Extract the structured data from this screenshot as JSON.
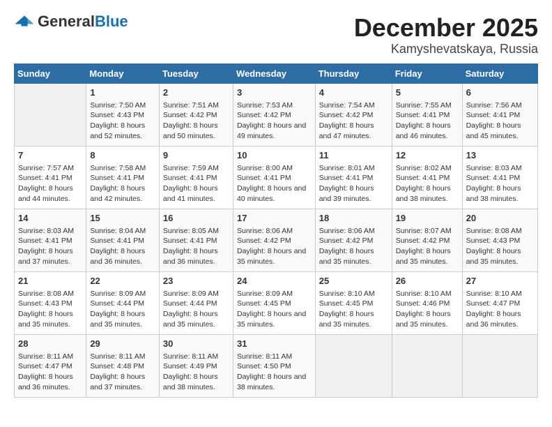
{
  "logo": {
    "line1": "General",
    "line2": "Blue"
  },
  "title": "December 2025",
  "subtitle": "Kamyshevatskaya, Russia",
  "days_header": [
    "Sunday",
    "Monday",
    "Tuesday",
    "Wednesday",
    "Thursday",
    "Friday",
    "Saturday"
  ],
  "weeks": [
    [
      {
        "day": "",
        "sunrise": "",
        "sunset": "",
        "daylight": ""
      },
      {
        "day": "1",
        "sunrise": "Sunrise: 7:50 AM",
        "sunset": "Sunset: 4:43 PM",
        "daylight": "Daylight: 8 hours and 52 minutes."
      },
      {
        "day": "2",
        "sunrise": "Sunrise: 7:51 AM",
        "sunset": "Sunset: 4:42 PM",
        "daylight": "Daylight: 8 hours and 50 minutes."
      },
      {
        "day": "3",
        "sunrise": "Sunrise: 7:53 AM",
        "sunset": "Sunset: 4:42 PM",
        "daylight": "Daylight: 8 hours and 49 minutes."
      },
      {
        "day": "4",
        "sunrise": "Sunrise: 7:54 AM",
        "sunset": "Sunset: 4:42 PM",
        "daylight": "Daylight: 8 hours and 47 minutes."
      },
      {
        "day": "5",
        "sunrise": "Sunrise: 7:55 AM",
        "sunset": "Sunset: 4:41 PM",
        "daylight": "Daylight: 8 hours and 46 minutes."
      },
      {
        "day": "6",
        "sunrise": "Sunrise: 7:56 AM",
        "sunset": "Sunset: 4:41 PM",
        "daylight": "Daylight: 8 hours and 45 minutes."
      }
    ],
    [
      {
        "day": "7",
        "sunrise": "Sunrise: 7:57 AM",
        "sunset": "Sunset: 4:41 PM",
        "daylight": "Daylight: 8 hours and 44 minutes."
      },
      {
        "day": "8",
        "sunrise": "Sunrise: 7:58 AM",
        "sunset": "Sunset: 4:41 PM",
        "daylight": "Daylight: 8 hours and 42 minutes."
      },
      {
        "day": "9",
        "sunrise": "Sunrise: 7:59 AM",
        "sunset": "Sunset: 4:41 PM",
        "daylight": "Daylight: 8 hours and 41 minutes."
      },
      {
        "day": "10",
        "sunrise": "Sunrise: 8:00 AM",
        "sunset": "Sunset: 4:41 PM",
        "daylight": "Daylight: 8 hours and 40 minutes."
      },
      {
        "day": "11",
        "sunrise": "Sunrise: 8:01 AM",
        "sunset": "Sunset: 4:41 PM",
        "daylight": "Daylight: 8 hours and 39 minutes."
      },
      {
        "day": "12",
        "sunrise": "Sunrise: 8:02 AM",
        "sunset": "Sunset: 4:41 PM",
        "daylight": "Daylight: 8 hours and 38 minutes."
      },
      {
        "day": "13",
        "sunrise": "Sunrise: 8:03 AM",
        "sunset": "Sunset: 4:41 PM",
        "daylight": "Daylight: 8 hours and 38 minutes."
      }
    ],
    [
      {
        "day": "14",
        "sunrise": "Sunrise: 8:03 AM",
        "sunset": "Sunset: 4:41 PM",
        "daylight": "Daylight: 8 hours and 37 minutes."
      },
      {
        "day": "15",
        "sunrise": "Sunrise: 8:04 AM",
        "sunset": "Sunset: 4:41 PM",
        "daylight": "Daylight: 8 hours and 36 minutes."
      },
      {
        "day": "16",
        "sunrise": "Sunrise: 8:05 AM",
        "sunset": "Sunset: 4:41 PM",
        "daylight": "Daylight: 8 hours and 36 minutes."
      },
      {
        "day": "17",
        "sunrise": "Sunrise: 8:06 AM",
        "sunset": "Sunset: 4:42 PM",
        "daylight": "Daylight: 8 hours and 35 minutes."
      },
      {
        "day": "18",
        "sunrise": "Sunrise: 8:06 AM",
        "sunset": "Sunset: 4:42 PM",
        "daylight": "Daylight: 8 hours and 35 minutes."
      },
      {
        "day": "19",
        "sunrise": "Sunrise: 8:07 AM",
        "sunset": "Sunset: 4:42 PM",
        "daylight": "Daylight: 8 hours and 35 minutes."
      },
      {
        "day": "20",
        "sunrise": "Sunrise: 8:08 AM",
        "sunset": "Sunset: 4:43 PM",
        "daylight": "Daylight: 8 hours and 35 minutes."
      }
    ],
    [
      {
        "day": "21",
        "sunrise": "Sunrise: 8:08 AM",
        "sunset": "Sunset: 4:43 PM",
        "daylight": "Daylight: 8 hours and 35 minutes."
      },
      {
        "day": "22",
        "sunrise": "Sunrise: 8:09 AM",
        "sunset": "Sunset: 4:44 PM",
        "daylight": "Daylight: 8 hours and 35 minutes."
      },
      {
        "day": "23",
        "sunrise": "Sunrise: 8:09 AM",
        "sunset": "Sunset: 4:44 PM",
        "daylight": "Daylight: 8 hours and 35 minutes."
      },
      {
        "day": "24",
        "sunrise": "Sunrise: 8:09 AM",
        "sunset": "Sunset: 4:45 PM",
        "daylight": "Daylight: 8 hours and 35 minutes."
      },
      {
        "day": "25",
        "sunrise": "Sunrise: 8:10 AM",
        "sunset": "Sunset: 4:45 PM",
        "daylight": "Daylight: 8 hours and 35 minutes."
      },
      {
        "day": "26",
        "sunrise": "Sunrise: 8:10 AM",
        "sunset": "Sunset: 4:46 PM",
        "daylight": "Daylight: 8 hours and 35 minutes."
      },
      {
        "day": "27",
        "sunrise": "Sunrise: 8:10 AM",
        "sunset": "Sunset: 4:47 PM",
        "daylight": "Daylight: 8 hours and 36 minutes."
      }
    ],
    [
      {
        "day": "28",
        "sunrise": "Sunrise: 8:11 AM",
        "sunset": "Sunset: 4:47 PM",
        "daylight": "Daylight: 8 hours and 36 minutes."
      },
      {
        "day": "29",
        "sunrise": "Sunrise: 8:11 AM",
        "sunset": "Sunset: 4:48 PM",
        "daylight": "Daylight: 8 hours and 37 minutes."
      },
      {
        "day": "30",
        "sunrise": "Sunrise: 8:11 AM",
        "sunset": "Sunset: 4:49 PM",
        "daylight": "Daylight: 8 hours and 38 minutes."
      },
      {
        "day": "31",
        "sunrise": "Sunrise: 8:11 AM",
        "sunset": "Sunset: 4:50 PM",
        "daylight": "Daylight: 8 hours and 38 minutes."
      },
      {
        "day": "",
        "sunrise": "",
        "sunset": "",
        "daylight": ""
      },
      {
        "day": "",
        "sunrise": "",
        "sunset": "",
        "daylight": ""
      },
      {
        "day": "",
        "sunrise": "",
        "sunset": "",
        "daylight": ""
      }
    ]
  ]
}
